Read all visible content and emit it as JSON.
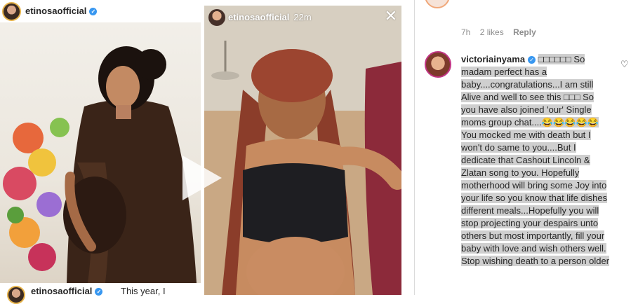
{
  "post": {
    "username": "etinosaofficial",
    "caption_prefix": "This year, I"
  },
  "story": {
    "username": "etinosaofficial",
    "time": "22m",
    "close_glyph": "✕"
  },
  "comment_meta": {
    "time": "7h",
    "likes": "2 likes",
    "reply": "Reply"
  },
  "comment": {
    "username": "victoriainyama",
    "text": "□□□□□□ So madam perfect has a baby....congratulations...I am still Alive and well to see this □□□ So you have also joined 'our' Single moms group chat....😂😂😂😂😂 You mocked me with death but I won't do same to you....But I dedicate that Cashout Lincoln & Zlatan song to you. Hopefully motherhood will bring some Joy into your life so you know that life dishes different meals...Hopefully you will stop projecting your despairs unto others but most importantly, fill your baby with love and wish others well. Stop wishing death to a person older"
  },
  "icons": {
    "verified": "verified-badge-icon",
    "heart": "heart-icon",
    "play": "play-icon",
    "close": "close-icon"
  },
  "colors": {
    "verified_blue": "#3897f0",
    "highlight_gray": "#cfcfcf",
    "meta_gray": "#8e8e8e"
  }
}
